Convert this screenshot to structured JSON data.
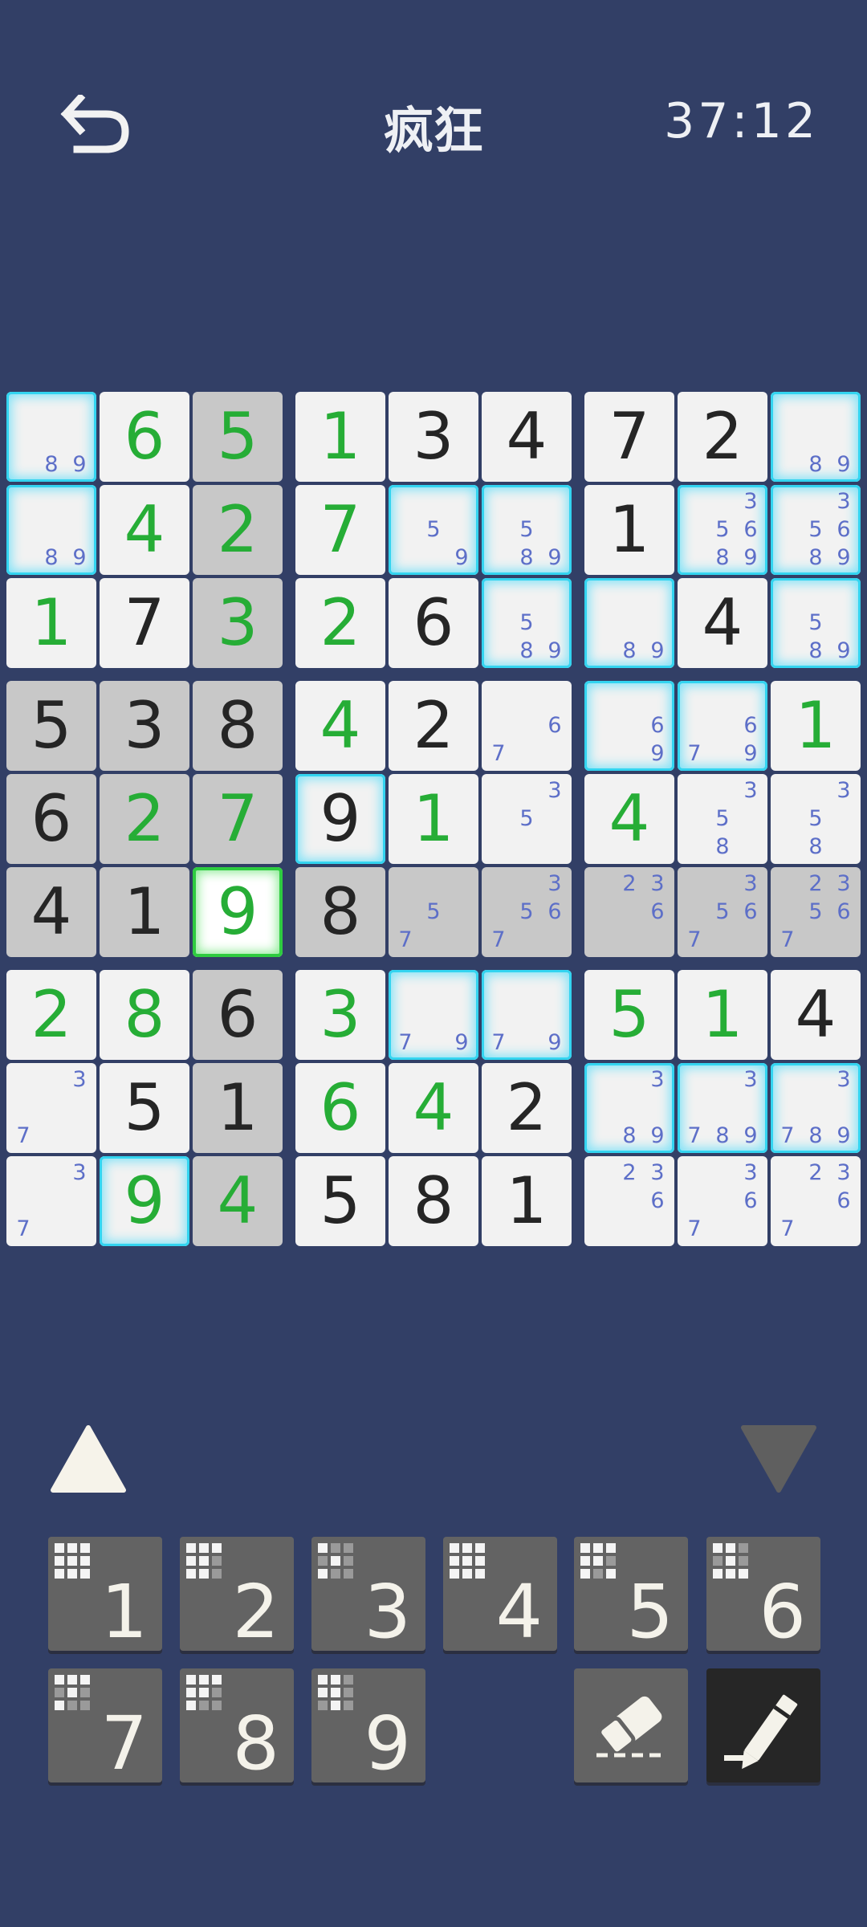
{
  "header": {
    "title": "疯狂",
    "timer": "37:12",
    "back_icon": "undo-arrow-icon"
  },
  "grid": [
    [
      {
        "n": "89"
      },
      {
        "v": 6,
        "u": 1
      },
      {
        "v": 5,
        "u": 1
      },
      {
        "v": 1,
        "u": 1
      },
      {
        "v": 3
      },
      {
        "v": 4
      },
      {
        "v": 7
      },
      {
        "v": 2
      },
      {
        "n": "89"
      }
    ],
    [
      {
        "n": "89"
      },
      {
        "v": 4,
        "u": 1
      },
      {
        "v": 2,
        "u": 1
      },
      {
        "v": 7,
        "u": 1
      },
      {
        "n": "59"
      },
      {
        "n": "589"
      },
      {
        "v": 1
      },
      {
        "n": "35689"
      },
      {
        "n": "35689"
      }
    ],
    [
      {
        "v": 1,
        "u": 1
      },
      {
        "v": 7
      },
      {
        "v": 3,
        "u": 1
      },
      {
        "v": 2,
        "u": 1
      },
      {
        "v": 6
      },
      {
        "n": "589"
      },
      {
        "n": "89"
      },
      {
        "v": 4
      },
      {
        "n": "589"
      }
    ],
    [
      {
        "v": 5
      },
      {
        "v": 3
      },
      {
        "v": 8
      },
      {
        "v": 4,
        "u": 1
      },
      {
        "v": 2
      },
      {
        "n": "67"
      },
      {
        "n": "69"
      },
      {
        "n": "679"
      },
      {
        "v": 1,
        "u": 1
      }
    ],
    [
      {
        "v": 6
      },
      {
        "v": 2,
        "u": 1
      },
      {
        "v": 7,
        "u": 1
      },
      {
        "v": 9
      },
      {
        "v": 1,
        "u": 1
      },
      {
        "n": "35"
      },
      {
        "v": 4,
        "u": 1
      },
      {
        "n": "358"
      },
      {
        "n": "358"
      }
    ],
    [
      {
        "v": 4
      },
      {
        "v": 1
      },
      {
        "v": 9,
        "u": 1
      },
      {
        "v": 8
      },
      {
        "n": "57"
      },
      {
        "n": "3567"
      },
      {
        "n": "236"
      },
      {
        "n": "3567"
      },
      {
        "n": "23567"
      }
    ],
    [
      {
        "v": 2,
        "u": 1
      },
      {
        "v": 8,
        "u": 1
      },
      {
        "v": 6
      },
      {
        "v": 3,
        "u": 1
      },
      {
        "n": "79"
      },
      {
        "n": "79"
      },
      {
        "v": 5,
        "u": 1
      },
      {
        "v": 1,
        "u": 1
      },
      {
        "v": 4
      }
    ],
    [
      {
        "n": "37"
      },
      {
        "v": 5
      },
      {
        "v": 1
      },
      {
        "v": 6,
        "u": 1
      },
      {
        "v": 4,
        "u": 1
      },
      {
        "v": 2
      },
      {
        "n": "389"
      },
      {
        "n": "3789"
      },
      {
        "n": "3789"
      }
    ],
    [
      {
        "n": "37"
      },
      {
        "v": 9,
        "u": 1
      },
      {
        "v": 4,
        "u": 1
      },
      {
        "v": 5
      },
      {
        "v": 8
      },
      {
        "v": 1
      },
      {
        "n": "236"
      },
      {
        "n": "367"
      },
      {
        "n": "2367"
      }
    ]
  ],
  "highlight": {
    "selected_digit": 9,
    "selected_cell": [
      5,
      2
    ],
    "glow_cells": [
      [
        0,
        0
      ],
      [
        0,
        8
      ],
      [
        1,
        0
      ],
      [
        1,
        4
      ],
      [
        1,
        5
      ],
      [
        1,
        7
      ],
      [
        1,
        8
      ],
      [
        2,
        5
      ],
      [
        2,
        6
      ],
      [
        2,
        8
      ],
      [
        3,
        6
      ],
      [
        3,
        7
      ],
      [
        4,
        3
      ],
      [
        6,
        4
      ],
      [
        6,
        5
      ],
      [
        7,
        6
      ],
      [
        7,
        7
      ],
      [
        7,
        8
      ],
      [
        8,
        1
      ]
    ],
    "gray_cells": [
      [
        0,
        2
      ],
      [
        1,
        2
      ],
      [
        2,
        2
      ],
      [
        3,
        0
      ],
      [
        3,
        1
      ],
      [
        3,
        2
      ],
      [
        4,
        0
      ],
      [
        4,
        1
      ],
      [
        4,
        2
      ],
      [
        5,
        0
      ],
      [
        5,
        1
      ],
      [
        5,
        3
      ],
      [
        5,
        4
      ],
      [
        5,
        5
      ],
      [
        5,
        6
      ],
      [
        5,
        7
      ],
      [
        5,
        8
      ],
      [
        6,
        2
      ],
      [
        7,
        2
      ],
      [
        8,
        2
      ]
    ]
  },
  "controls": {
    "up_icon": "triangle-up-icon",
    "down_icon": "triangle-down-icon",
    "number_buttons": [
      {
        "label": "1",
        "mini_off": []
      },
      {
        "label": "2",
        "mini_off": [
          5,
          8
        ]
      },
      {
        "label": "3",
        "mini_off": [
          1,
          2,
          3,
          5,
          7,
          8
        ]
      },
      {
        "label": "4",
        "mini_off": []
      },
      {
        "label": "5",
        "mini_off": [
          5,
          7
        ]
      },
      {
        "label": "6",
        "mini_off": [
          2,
          3,
          5
        ]
      },
      {
        "label": "7",
        "mini_off": [
          3,
          5,
          7,
          8
        ]
      },
      {
        "label": "8",
        "mini_off": [
          5,
          7,
          8
        ]
      },
      {
        "label": "9",
        "mini_off": [
          2,
          5,
          6,
          8
        ]
      }
    ],
    "eraser_icon": "eraser-icon",
    "pencil_icon": "pencil-icon"
  },
  "colors": {
    "background": "#323f66",
    "given_digit": "#252525",
    "user_digit": "#26ad36",
    "note_digit": "#5d6fc8",
    "glow": "#33d4f0",
    "selected_border": "#2ecc40"
  }
}
